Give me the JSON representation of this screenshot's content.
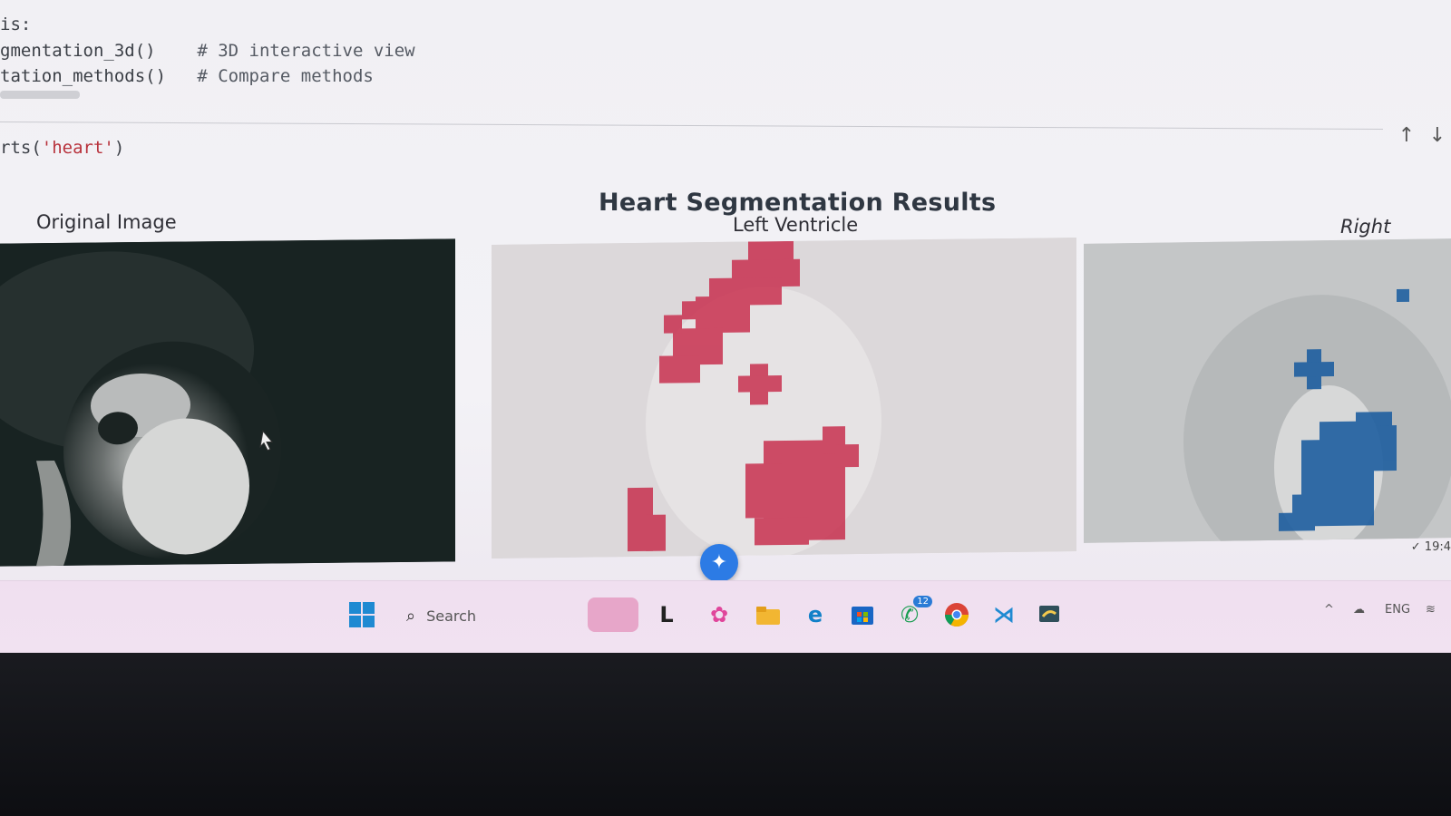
{
  "code_lines": {
    "line1": "is:",
    "line2_code": "gmentation_3d()",
    "line2_comment": "# 3D interactive view",
    "line3_code": "tation_methods()",
    "line3_comment": "# Compare methods",
    "cell_call_prefix": "rts(",
    "cell_call_arg": "'heart'",
    "cell_call_suffix": ")"
  },
  "cell_toolbar": {
    "move_up_icon": "arrow-up-icon",
    "move_down_icon": "arrow-down-icon"
  },
  "figure": {
    "title": "Heart Segmentation Results",
    "panels": [
      {
        "label": "Original Image",
        "colormap": "gray"
      },
      {
        "label": "Left Ventricle",
        "overlay_color": "#c8314f"
      },
      {
        "label": "Right Ventricle",
        "overlay_color": "#1f5fa0"
      }
    ]
  },
  "status": {
    "time_text": "19:4"
  },
  "taskbar": {
    "search_placeholder": "Search",
    "apps": [
      "windows-start-icon",
      "search-icon",
      "widgets-icon",
      "file-app-icon",
      "copilot-icon",
      "file-explorer-icon",
      "edge-icon",
      "store-icon",
      "whatsapp-icon",
      "chrome-icon",
      "vscode-icon",
      "python-app-icon"
    ],
    "whatsapp_badge": "12",
    "tray": {
      "lang": "ENG"
    }
  },
  "colors": {
    "title": "#2f3742",
    "string": "#b8323c",
    "lv_mask": "#c8314f",
    "rv_mask": "#1f5fa0"
  }
}
